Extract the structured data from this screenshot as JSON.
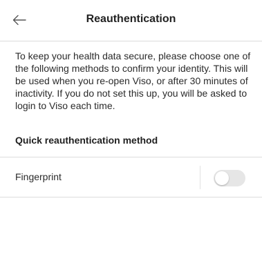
{
  "header": {
    "title": "Reauthentication",
    "back_icon": "arrow-left-icon"
  },
  "description": "To keep your health data secure, please choose one of the following methods to confirm your identity. This will be used when you re-open Viso, or after 30 minutes of inactivity. If you do not set this up, you will be asked to login to Viso each time.",
  "section": {
    "title": "Quick reauthentication method"
  },
  "options": [
    {
      "label": "Fingerprint",
      "enabled": false
    }
  ],
  "colors": {
    "background": "#ffffff",
    "divider": "#dcdcdc",
    "toggle_off": "#e6e6e6",
    "text": "#1f1f1f"
  }
}
